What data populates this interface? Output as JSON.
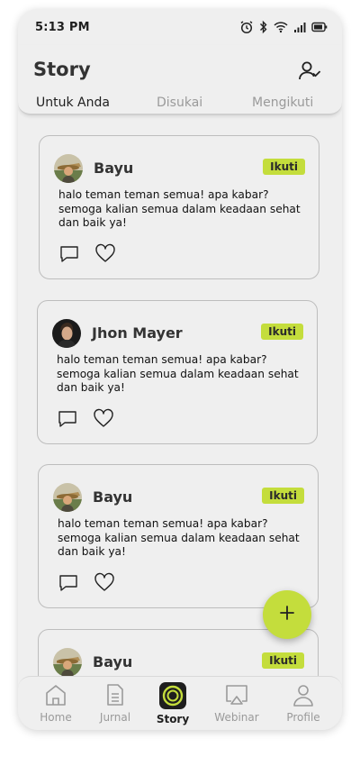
{
  "status_bar": {
    "time": "5:13 PM",
    "icons": [
      "alarm-icon",
      "bluetooth-icon",
      "wifi-icon",
      "signal-icon",
      "battery-icon"
    ]
  },
  "header": {
    "title": "Story",
    "action_icon": "user-check-icon"
  },
  "tabs": [
    {
      "label": "Untuk Anda",
      "active": true
    },
    {
      "label": "Disukai",
      "active": false
    },
    {
      "label": "Mengikuti",
      "active": false
    }
  ],
  "posts": [
    {
      "author": "Bayu",
      "follow_label": "Ikuti",
      "text": "halo teman teman semua! apa kabar? semoga kalian semua dalam keadaan sehat dan baik ya!"
    },
    {
      "author": "Jhon Mayer",
      "follow_label": "Ikuti",
      "text": "halo teman teman semua! apa kabar? semoga kalian semua dalam keadaan sehat dan baik ya!"
    },
    {
      "author": "Bayu",
      "follow_label": "Ikuti",
      "text": "halo teman teman semua! apa kabar? semoga kalian semua dalam keadaan sehat dan baik ya!"
    },
    {
      "author": "Bayu",
      "follow_label": "Ikuti",
      "text": ""
    }
  ],
  "fab": {
    "icon": "plus-icon"
  },
  "bottom_nav": [
    {
      "label": "Home",
      "icon": "home-icon",
      "active": false
    },
    {
      "label": "Jurnal",
      "icon": "journal-icon",
      "active": false
    },
    {
      "label": "Story",
      "icon": "story-icon",
      "active": true
    },
    {
      "label": "Webinar",
      "icon": "webinar-icon",
      "active": false
    },
    {
      "label": "Profile",
      "icon": "profile-icon",
      "active": false
    }
  ],
  "colors": {
    "accent": "#c4dd3c",
    "background": "#efefef",
    "inactive": "#9a9a9a"
  }
}
